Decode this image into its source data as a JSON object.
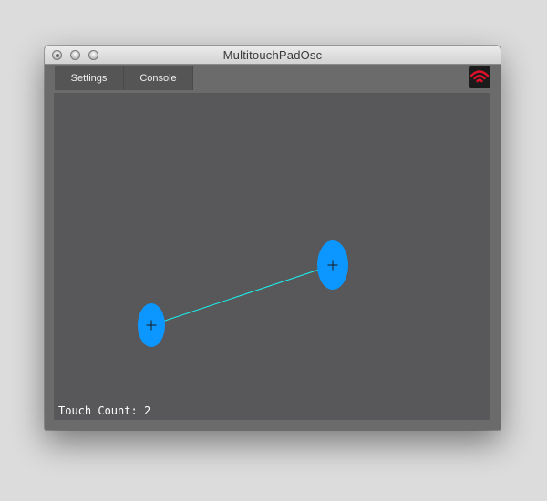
{
  "window": {
    "title": "MultitouchPadOsc"
  },
  "toolbar": {
    "tabs": [
      {
        "label": "Settings"
      },
      {
        "label": "Console"
      }
    ],
    "connection_icon": "wifi-signal-icon",
    "connection_color": "#e0102a"
  },
  "pad": {
    "background": "#58585a",
    "touch_color": "#0b97ff",
    "line_color": "#19f2f2",
    "touch_count_label": "Touch Count:",
    "touch_count": 2
  }
}
